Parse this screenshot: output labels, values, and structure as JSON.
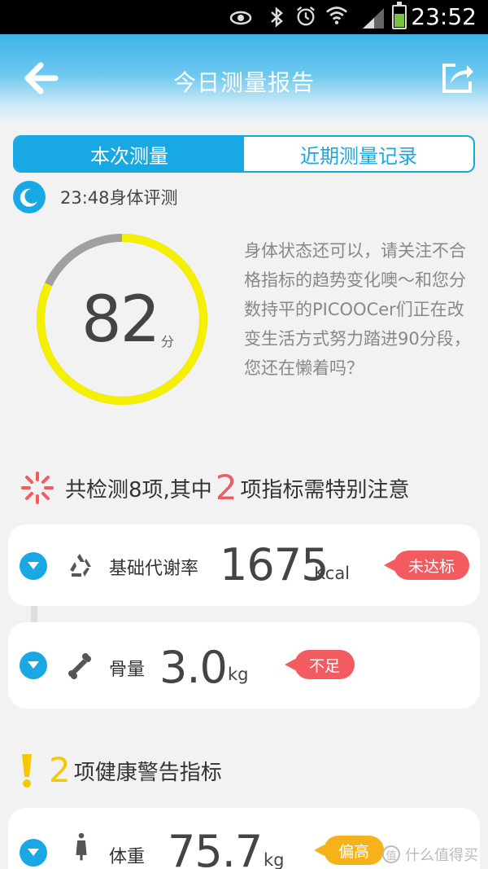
{
  "status_bar": {
    "time": "23:52",
    "icons": [
      "eye-icon",
      "bluetooth-icon",
      "alarm-icon",
      "wifi-icon",
      "signal-icon",
      "battery-icon"
    ]
  },
  "header": {
    "title": "今日测量报告",
    "back_icon": "back-arrow-icon",
    "share_icon": "share-icon"
  },
  "tabs": [
    {
      "label": "本次测量",
      "active": true
    },
    {
      "label": "近期测量记录",
      "active": false
    }
  ],
  "evaluation": {
    "icon": "moon-icon",
    "label": "23:48身体评测"
  },
  "score": {
    "value": "82",
    "unit": "分",
    "ring_fraction": 0.82,
    "ring_color": "#f5f000",
    "ring_track_color": "#a0a0a0"
  },
  "description": "身体状态还可以，请关注不合格指标的趋势变化噢～和您分数持平的PICOOCer们正在改变生活方式努力踏进90分段，您还在懒着吗？",
  "section_attention": {
    "prefix": "共检测8项,其中",
    "count": "2",
    "suffix": "项指标需特别注意"
  },
  "attention_items": [
    {
      "icon": "recycle-icon",
      "label": "基础代谢率",
      "value": "1675",
      "unit": "Kcal",
      "badge": "未达标"
    },
    {
      "icon": "bone-icon",
      "label": "骨量",
      "value": "3.0",
      "unit": "kg",
      "badge": "不足"
    }
  ],
  "section_warning": {
    "count": "2",
    "suffix": "项健康警告指标"
  },
  "warning_items": [
    {
      "icon": "person-icon",
      "label": "体重",
      "value": "75.7",
      "unit": "kg",
      "badge": "偏高"
    }
  ],
  "watermark": {
    "icon_text": "值",
    "text": "什么值得买"
  },
  "colors": {
    "accent": "#18a9e5",
    "red": "#f25b60",
    "yellow": "#f5c800",
    "orange": "#f6b21b"
  }
}
